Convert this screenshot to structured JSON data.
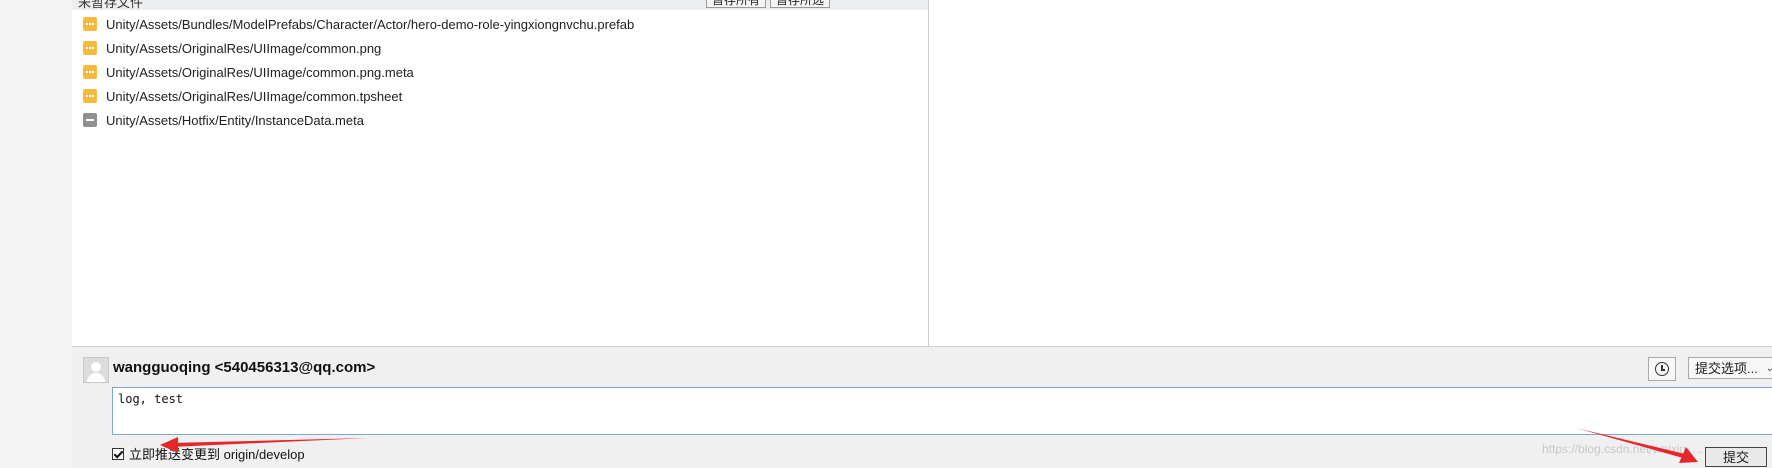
{
  "file_pane": {
    "header_title": "未暂存文件",
    "stage_all_label": "暂存所有",
    "stage_selected_label": "暂存所选",
    "files": [
      {
        "path": "Unity/Assets/Bundles/ModelPrefabs/Character/Actor/hero-demo-role-yingxiongnvchu.prefab",
        "status": "modified",
        "icon": "modified-file-icon"
      },
      {
        "path": "Unity/Assets/OriginalRes/UIImage/common.png",
        "status": "modified",
        "icon": "modified-file-icon"
      },
      {
        "path": "Unity/Assets/OriginalRes/UIImage/common.png.meta",
        "status": "modified",
        "icon": "modified-file-icon"
      },
      {
        "path": "Unity/Assets/OriginalRes/UIImage/common.tpsheet",
        "status": "modified",
        "icon": "modified-file-icon"
      },
      {
        "path": "Unity/Assets/Hotfix/Entity/InstanceData.meta",
        "status": "removed",
        "icon": "removed-file-icon"
      }
    ]
  },
  "commit": {
    "author": "wangguoqing <540456313@qq.com>",
    "options_label": "提交选项...",
    "message": "log, test",
    "push_label": "立即推送变更到 origin/develop",
    "push_checked": true,
    "commit_label": "提交"
  },
  "watermark": "https://blog.csdn.net/weixin_...",
  "colors": {
    "modified": "#f6b941",
    "removed": "#8f8f8f",
    "annotation_arrow": "#e5262a",
    "focus_border": "#7fa7d6"
  }
}
